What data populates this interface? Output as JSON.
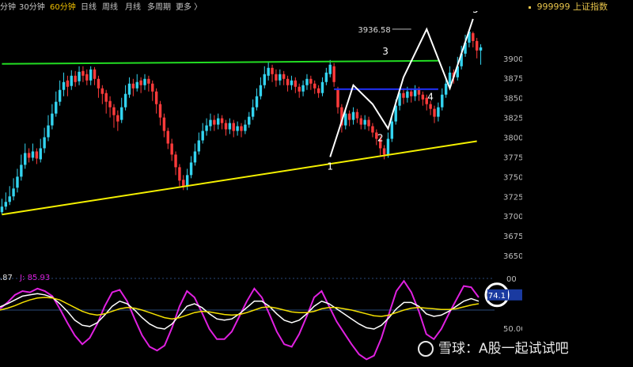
{
  "toolbar": {
    "items": [
      "分钟",
      "30分钟",
      "60分钟",
      "日线",
      "周线",
      "月线",
      "多周期",
      "更多 〉"
    ],
    "active_index": 2
  },
  "stock": {
    "code": "999999",
    "name": "上证指数"
  },
  "chart_data": {
    "type": "candlestick",
    "price_axis": {
      "ticks": [
        3900,
        3875,
        3850,
        3825,
        3800,
        3775,
        3750,
        3725,
        3700,
        3675,
        3650
      ],
      "range": [
        3627,
        3960
      ]
    },
    "candles": [
      [
        3712,
        3705,
        3722,
        3702
      ],
      [
        3718,
        3712,
        3730,
        3708
      ],
      [
        3725,
        3718,
        3738,
        3714
      ],
      [
        3735,
        3725,
        3748,
        3720
      ],
      [
        3750,
        3736,
        3760,
        3730
      ],
      [
        3765,
        3750,
        3778,
        3745
      ],
      [
        3780,
        3765,
        3792,
        3760
      ],
      [
        3774,
        3780,
        3786,
        3768
      ],
      [
        3782,
        3774,
        3792,
        3770
      ],
      [
        3773,
        3782,
        3786,
        3766
      ],
      [
        3786,
        3772,
        3798,
        3768
      ],
      [
        3800,
        3786,
        3812,
        3780
      ],
      [
        3815,
        3800,
        3828,
        3795
      ],
      [
        3830,
        3815,
        3842,
        3810
      ],
      [
        3845,
        3830,
        3858,
        3826
      ],
      [
        3860,
        3845,
        3872,
        3840
      ],
      [
        3870,
        3860,
        3882,
        3852
      ],
      [
        3864,
        3872,
        3878,
        3852
      ],
      [
        3878,
        3865,
        3885,
        3860
      ],
      [
        3870,
        3878,
        3884,
        3864
      ],
      [
        3883,
        3871,
        3890,
        3866
      ],
      [
        3878,
        3884,
        3890,
        3870
      ],
      [
        3872,
        3880,
        3886,
        3866
      ],
      [
        3886,
        3872,
        3890,
        3866
      ],
      [
        3874,
        3886,
        3889,
        3866
      ],
      [
        3862,
        3874,
        3878,
        3850
      ],
      [
        3855,
        3862,
        3866,
        3842
      ],
      [
        3845,
        3856,
        3860,
        3830
      ],
      [
        3838,
        3846,
        3852,
        3825
      ],
      [
        3828,
        3838,
        3842,
        3812
      ],
      [
        3820,
        3828,
        3834,
        3808
      ],
      [
        3838,
        3822,
        3850,
        3818
      ],
      [
        3855,
        3838,
        3866,
        3834
      ],
      [
        3868,
        3854,
        3876,
        3850
      ],
      [
        3862,
        3868,
        3874,
        3852
      ],
      [
        3870,
        3862,
        3880,
        3858
      ],
      [
        3866,
        3872,
        3876,
        3856
      ],
      [
        3874,
        3866,
        3880,
        3860
      ],
      [
        3868,
        3874,
        3878,
        3858
      ],
      [
        3858,
        3868,
        3872,
        3846
      ],
      [
        3842,
        3858,
        3862,
        3830
      ],
      [
        3825,
        3842,
        3846,
        3815
      ],
      [
        3808,
        3825,
        3830,
        3800
      ],
      [
        3792,
        3808,
        3812,
        3785
      ],
      [
        3778,
        3792,
        3798,
        3770
      ],
      [
        3762,
        3778,
        3782,
        3752
      ],
      [
        3745,
        3762,
        3766,
        3738
      ],
      [
        3738,
        3746,
        3752,
        3733
      ],
      [
        3752,
        3738,
        3760,
        3733
      ],
      [
        3768,
        3752,
        3776,
        3748
      ],
      [
        3782,
        3768,
        3792,
        3764
      ],
      [
        3796,
        3782,
        3806,
        3778
      ],
      [
        3808,
        3796,
        3818,
        3792
      ],
      [
        3815,
        3808,
        3824,
        3802
      ],
      [
        3822,
        3814,
        3830,
        3808
      ],
      [
        3816,
        3822,
        3828,
        3808
      ],
      [
        3824,
        3816,
        3830,
        3810
      ],
      [
        3818,
        3824,
        3828,
        3810
      ],
      [
        3810,
        3818,
        3822,
        3802
      ],
      [
        3818,
        3810,
        3824,
        3804
      ],
      [
        3808,
        3818,
        3822,
        3800
      ],
      [
        3814,
        3808,
        3820,
        3802
      ],
      [
        3808,
        3814,
        3818,
        3800
      ],
      [
        3816,
        3808,
        3822,
        3804
      ],
      [
        3826,
        3816,
        3832,
        3812
      ],
      [
        3838,
        3826,
        3848,
        3822
      ],
      [
        3852,
        3838,
        3862,
        3834
      ],
      [
        3866,
        3852,
        3876,
        3848
      ],
      [
        3880,
        3866,
        3890,
        3862
      ],
      [
        3888,
        3878,
        3896,
        3872
      ],
      [
        3880,
        3888,
        3892,
        3870
      ],
      [
        3872,
        3880,
        3886,
        3864
      ],
      [
        3880,
        3872,
        3886,
        3866
      ],
      [
        3874,
        3880,
        3884,
        3866
      ],
      [
        3866,
        3874,
        3878,
        3858
      ],
      [
        3872,
        3866,
        3878,
        3860
      ],
      [
        3864,
        3872,
        3876,
        3856
      ],
      [
        3858,
        3864,
        3868,
        3850
      ],
      [
        3866,
        3858,
        3872,
        3852
      ],
      [
        3874,
        3866,
        3880,
        3860
      ],
      [
        3868,
        3874,
        3878,
        3860
      ],
      [
        3862,
        3868,
        3872,
        3855
      ],
      [
        3856,
        3862,
        3866,
        3850
      ],
      [
        3870,
        3856,
        3876,
        3852
      ],
      [
        3882,
        3870,
        3888,
        3866
      ],
      [
        3892,
        3880,
        3898,
        3876
      ],
      [
        3870,
        3890,
        3894,
        3864
      ],
      [
        3838,
        3860,
        3864,
        3830
      ],
      [
        3815,
        3838,
        3842,
        3806
      ],
      [
        3830,
        3815,
        3836,
        3810
      ],
      [
        3822,
        3830,
        3834,
        3814
      ],
      [
        3832,
        3822,
        3838,
        3816
      ],
      [
        3824,
        3832,
        3836,
        3818
      ],
      [
        3816,
        3824,
        3828,
        3810
      ],
      [
        3822,
        3816,
        3828,
        3810
      ],
      [
        3814,
        3822,
        3826,
        3808
      ],
      [
        3806,
        3814,
        3818,
        3800
      ],
      [
        3798,
        3806,
        3810,
        3790
      ],
      [
        3786,
        3798,
        3802,
        3776
      ],
      [
        3778,
        3786,
        3790,
        3772
      ],
      [
        3798,
        3778,
        3806,
        3774
      ],
      [
        3820,
        3798,
        3830,
        3794
      ],
      [
        3840,
        3820,
        3848,
        3816
      ],
      [
        3856,
        3840,
        3862,
        3834
      ],
      [
        3850,
        3856,
        3862,
        3842
      ],
      [
        3858,
        3850,
        3864,
        3844
      ],
      [
        3852,
        3858,
        3862,
        3844
      ],
      [
        3860,
        3852,
        3866,
        3846
      ],
      [
        3854,
        3860,
        3864,
        3846
      ],
      [
        3848,
        3854,
        3858,
        3840
      ],
      [
        3842,
        3850,
        3854,
        3834
      ],
      [
        3836,
        3842,
        3846,
        3828
      ],
      [
        3826,
        3836,
        3840,
        3818
      ],
      [
        3838,
        3826,
        3844,
        3820
      ],
      [
        3854,
        3838,
        3862,
        3834
      ],
      [
        3868,
        3854,
        3876,
        3850
      ],
      [
        3882,
        3868,
        3890,
        3864
      ],
      [
        3876,
        3882,
        3886,
        3868
      ],
      [
        3890,
        3876,
        3902,
        3872
      ],
      [
        3906,
        3890,
        3916,
        3886
      ],
      [
        3920,
        3906,
        3930,
        3902
      ],
      [
        3934,
        3920,
        3937,
        3914
      ],
      [
        3922,
        3932,
        3934,
        3914
      ],
      [
        3910,
        3922,
        3926,
        3900
      ],
      [
        3914,
        3910,
        3918,
        3892
      ]
    ],
    "lines": [
      {
        "name": "green",
        "color": "#22dd22",
        "points": [
          [
            0,
            3893
          ],
          [
            113,
            3897
          ]
        ]
      },
      {
        "name": "blue",
        "color": "#2233ff",
        "points": [
          [
            86,
            3861
          ],
          [
            113,
            3861
          ]
        ]
      },
      {
        "name": "yellow",
        "color": "#f4f000",
        "points": [
          [
            0,
            3702
          ],
          [
            123,
            3795
          ]
        ]
      },
      {
        "name": "white",
        "color": "#ffffff",
        "points": [
          [
            85,
            3775
          ],
          [
            91,
            3866
          ],
          [
            96,
            3842
          ],
          [
            100,
            3811
          ],
          [
            104,
            3876
          ],
          [
            110,
            3937
          ],
          [
            116,
            3862
          ],
          [
            122,
            3950
          ]
        ]
      }
    ],
    "wave_labels": [
      {
        "text": "1",
        "x": 85,
        "y": 3775
      },
      {
        "text": "2",
        "x": 98,
        "y": 3811
      },
      {
        "text": "3",
        "x": 103,
        "y": 3900
      },
      {
        "text": "4",
        "x": 111,
        "y": 3863
      },
      {
        "text": "5",
        "x": 121,
        "y": 3950
      }
    ],
    "annotations": [
      {
        "text": "3936.58",
        "x": 106,
        "y": 3937
      }
    ],
    "indicator": {
      "name": "KDJ",
      "k_label": ".87",
      "j_label": "J: 85.93",
      "ticks": [
        "00",
        "50.00"
      ],
      "current_label": "74.1",
      "range": [
        -40,
        110
      ],
      "series": [
        {
          "name": "J",
          "color": "#e020e0",
          "values": [
            52,
            62,
            74,
            80,
            78,
            84,
            80,
            72,
            52,
            30,
            10,
            -4,
            6,
            28,
            56,
            78,
            82,
            64,
            36,
            10,
            -8,
            -14,
            -6,
            22,
            56,
            80,
            70,
            46,
            20,
            4,
            4,
            16,
            40,
            64,
            84,
            70,
            44,
            16,
            -4,
            -8,
            12,
            40,
            70,
            80,
            56,
            32,
            14,
            -4,
            -20,
            -28,
            -22,
            6,
            44,
            80,
            96,
            78,
            48,
            12,
            4,
            20,
            44,
            66,
            88,
            86,
            70
          ]
        },
        {
          "name": "K",
          "color": "#ffffff",
          "values": [
            55,
            60,
            66,
            72,
            74,
            76,
            74,
            70,
            60,
            48,
            34,
            26,
            24,
            30,
            42,
            56,
            64,
            60,
            50,
            38,
            28,
            22,
            20,
            28,
            42,
            56,
            60,
            54,
            44,
            36,
            34,
            36,
            44,
            54,
            64,
            64,
            56,
            44,
            34,
            30,
            34,
            44,
            56,
            64,
            60,
            52,
            44,
            36,
            28,
            22,
            20,
            26,
            38,
            52,
            62,
            62,
            56,
            44,
            40,
            42,
            48,
            56,
            64,
            68,
            64
          ]
        },
        {
          "name": "D",
          "color": "#f4e000",
          "values": [
            50,
            53,
            57,
            62,
            66,
            69,
            70,
            69,
            66,
            60,
            54,
            48,
            44,
            42,
            44,
            48,
            52,
            54,
            53,
            50,
            46,
            42,
            38,
            36,
            38,
            42,
            46,
            48,
            47,
            45,
            43,
            42,
            43,
            46,
            50,
            54,
            55,
            53,
            50,
            47,
            46,
            46,
            48,
            52,
            54,
            54,
            52,
            50,
            47,
            44,
            41,
            40,
            42,
            46,
            50,
            53,
            54,
            53,
            52,
            51,
            51,
            52,
            55,
            58,
            60
          ]
        }
      ]
    }
  },
  "watermark": {
    "text": "雪球：A股一起试试吧"
  }
}
